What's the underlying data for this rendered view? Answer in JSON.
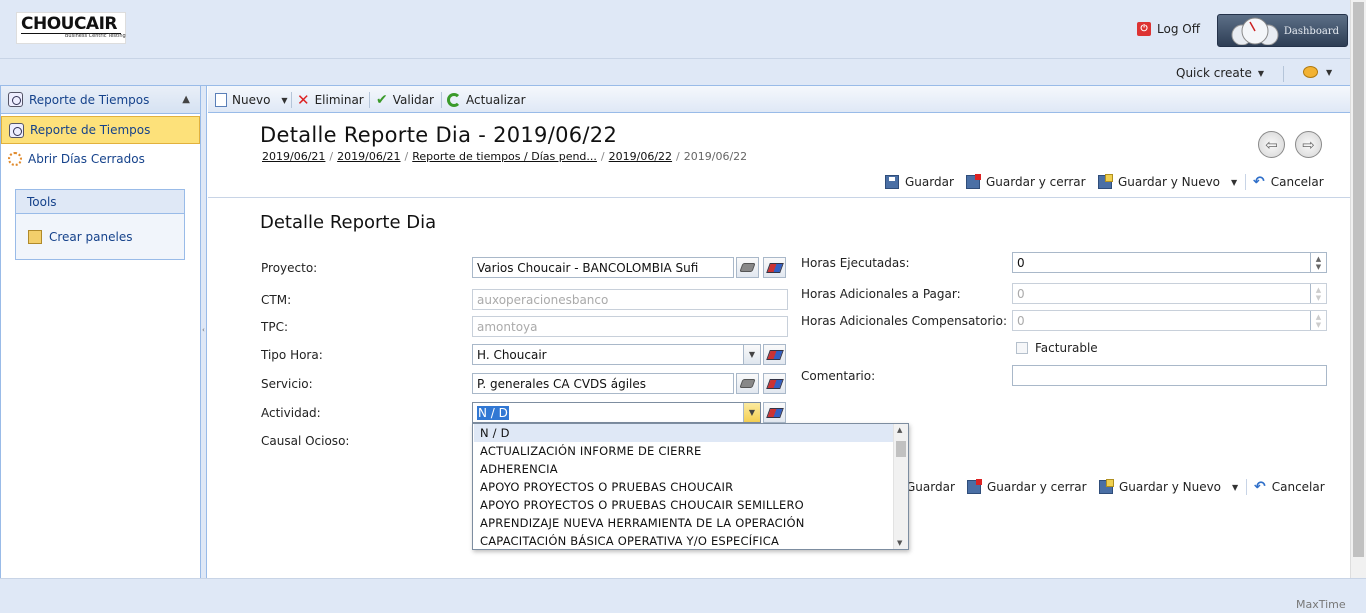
{
  "header": {
    "logo_text": "CHOUCAIR",
    "logo_tagline": "Business Centric Testing",
    "logoff_label": "Log Off",
    "dashboard_label": "Dashboard",
    "quick_create_label": "Quick create"
  },
  "sidebar": {
    "panel_title": "Reporte de Tiempos",
    "items": [
      {
        "label": "Reporte de Tiempos",
        "icon": "clock-icon",
        "selected": true
      },
      {
        "label": "Abrir Días Cerrados",
        "icon": "gear-icon",
        "selected": false
      }
    ],
    "tools_title": "Tools",
    "tools_item": "Crear paneles"
  },
  "toolbar": {
    "new_label": "Nuevo",
    "delete_label": "Eliminar",
    "validate_label": "Validar",
    "refresh_label": "Actualizar"
  },
  "page": {
    "title": "Detalle Reporte Dia - 2019/06/22",
    "breadcrumbs": [
      "2019/06/21",
      "2019/06/21",
      "Reporte de tiempos / Días pend...",
      "2019/06/22"
    ],
    "breadcrumb_current": "2019/06/22",
    "section_title": "Detalle Reporte Dia"
  },
  "actions": {
    "save": "Guardar",
    "save_close": "Guardar y cerrar",
    "save_new": "Guardar y Nuevo",
    "cancel": "Cancelar"
  },
  "form": {
    "proyecto_label": "Proyecto:",
    "proyecto_value": "Varios Choucair - BANCOLOMBIA Sufi",
    "ctm_label": "CTM:",
    "ctm_value": "auxoperacionesbanco",
    "tpc_label": "TPC:",
    "tpc_value": "amontoya",
    "tipo_hora_label": "Tipo Hora:",
    "tipo_hora_value": "H. Choucair",
    "servicio_label": "Servicio:",
    "servicio_value": "P. generales CA CVDS ágiles",
    "actividad_label": "Actividad:",
    "actividad_value": "N / D",
    "causal_label": "Causal Ocioso:",
    "horas_ejecutadas_label": "Horas Ejecutadas:",
    "horas_ejecutadas_value": "0",
    "horas_adicionales_pagar_label": "Horas Adicionales a Pagar:",
    "horas_adicionales_pagar_value": "0",
    "horas_adicionales_comp_label": "Horas Adicionales Compensatorio:",
    "horas_adicionales_comp_value": "0",
    "facturable_label": "Facturable",
    "comentario_label": "Comentario:",
    "comentario_value": ""
  },
  "actividad_options": [
    "N / D",
    "ACTUALIZACIÓN INFORME DE CIERRE",
    "ADHERENCIA",
    "APOYO PROYECTOS O PRUEBAS CHOUCAIR",
    "APOYO PROYECTOS O PRUEBAS CHOUCAIR SEMILLERO",
    "APRENDIZAJE NUEVA HERRAMIENTA DE LA OPERACIÓN",
    "CAPACITACIÓN BÁSICA OPERATIVA Y/O ESPECÍFICA"
  ],
  "footer": {
    "brand": "MaxTime"
  },
  "colors": {
    "header_bg": "#dfe8f6",
    "selected_item_bg": "#fde17a",
    "link_color": "#15428b"
  }
}
